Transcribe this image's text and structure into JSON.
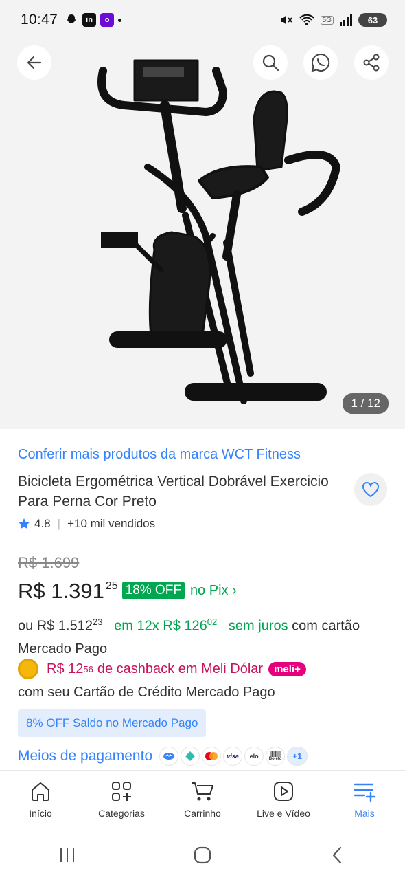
{
  "status_bar": {
    "time": "10:47",
    "network": "5G",
    "battery": "63"
  },
  "gallery": {
    "counter": "1 / 12"
  },
  "product": {
    "brand_link": "Conferir mais produtos da marca WCT Fitness",
    "title": "Bicicleta Ergométrica Vertical Dobrável Exercicio Para Perna Cor Preto",
    "rating": "4.8",
    "sold": "+10 mil vendidos",
    "old_price": "R$ 1.699",
    "price_main": "R$ 1.391",
    "price_cents": "25",
    "discount": "18% OFF",
    "pix": "no Pix ›",
    "installment": {
      "prefix": "ou R$ 1.512",
      "prefix_cents": "23",
      "count": "em 12x R$ 126",
      "count_cents": "02",
      "no_interest": "sem juros",
      "suffix": "com cartão Mercado Pago"
    },
    "cashback": {
      "amount": "R$ 12",
      "amount_cents": "56",
      "text": "de cashback em Meli Dólar",
      "badge": "meli+",
      "subtitle": "com seu Cartão de Crédito Mercado Pago"
    },
    "saldo_banner": "8% OFF Saldo no Mercado Pago",
    "payment": {
      "label": "Meios de pagamento",
      "methods": [
        "visa",
        "elo",
        "Boleto"
      ],
      "more": "+1"
    }
  },
  "tabbar": {
    "items": [
      {
        "label": "Início"
      },
      {
        "label": "Categorias"
      },
      {
        "label": "Carrinho"
      },
      {
        "label": "Live e Vídeo"
      },
      {
        "label": "Mais"
      }
    ]
  },
  "colors": {
    "brand_blue": "#3483fa",
    "discount_green": "#00a650",
    "cashback_pink": "#c6135a"
  }
}
